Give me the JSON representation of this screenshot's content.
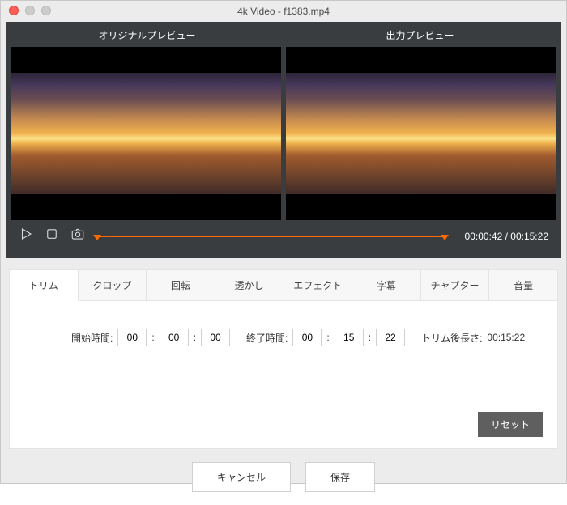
{
  "window": {
    "title": "4k Video - f1383.mp4"
  },
  "preview": {
    "original_label": "オリジナルプレビュー",
    "output_label": "出力プレビュー",
    "current_time": "00:00:42",
    "total_time": "00:15:22",
    "time_separator": " / "
  },
  "tabs": {
    "items": [
      {
        "label": "トリム"
      },
      {
        "label": "クロップ"
      },
      {
        "label": "回転"
      },
      {
        "label": "透かし"
      },
      {
        "label": "エフェクト"
      },
      {
        "label": "字幕"
      },
      {
        "label": "チャプター"
      },
      {
        "label": "音量"
      }
    ],
    "active_index": 0
  },
  "trim": {
    "start_label": "開始時間:",
    "end_label": "終了時間:",
    "length_label": "トリム後長さ:",
    "length_value": "00:15:22",
    "colon": ":",
    "start": {
      "hh": "00",
      "mm": "00",
      "ss": "00"
    },
    "end": {
      "hh": "00",
      "mm": "15",
      "ss": "22"
    },
    "reset_label": "リセット"
  },
  "footer": {
    "cancel_label": "キャンセル",
    "save_label": "保存"
  }
}
